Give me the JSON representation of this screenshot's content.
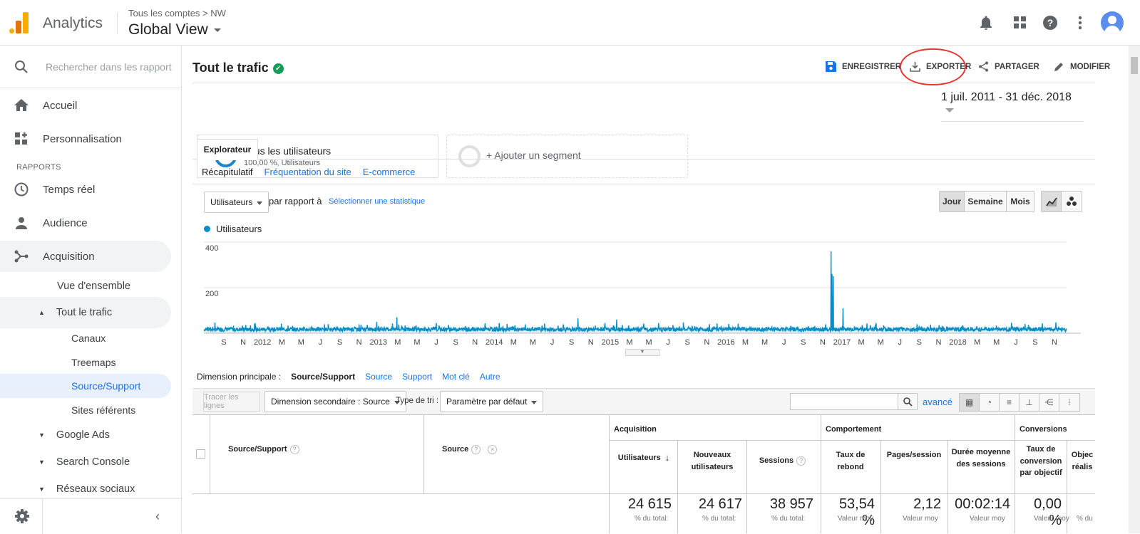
{
  "header": {
    "app_name": "Analytics",
    "breadcrumb": "Tous les comptes > NW",
    "view_name": "Global View",
    "icons": [
      "bell-icon",
      "apps-icon",
      "help-icon",
      "more-icon",
      "account-icon"
    ]
  },
  "sidebar": {
    "search_placeholder": "Rechercher dans les rapport",
    "home": "Accueil",
    "customization": "Personnalisation",
    "section_reports": "RAPPORTS",
    "realtime": "Temps réel",
    "audience": "Audience",
    "acquisition": "Acquisition",
    "overview": "Vue d'ensemble",
    "all_traffic": "Tout le trafic",
    "channels": "Canaux",
    "treemaps": "Treemaps",
    "source_medium": "Source/Support",
    "referrals": "Sites référents",
    "google_ads": "Google Ads",
    "search_console": "Search Console",
    "social": "Réseaux sociaux"
  },
  "page": {
    "title": "Tout le trafic",
    "actions": {
      "save": "ENREGISTRER",
      "export": "EXPORTER",
      "share": "PARTAGER",
      "edit": "MODIFIER"
    },
    "segment": {
      "name": "Tous les utilisateurs",
      "detail": "100,00 %, Utilisateurs",
      "add": "+ Ajouter un segment"
    },
    "date_range": "1 juil. 2011 - 31 déc. 2018",
    "tab": "Explorateur",
    "subtabs": [
      "Récapitulatif",
      "Fréquentation du site",
      "E-commerce"
    ],
    "metric_select": "Utilisateurs",
    "vs_label": "par rapport à",
    "select_metric_link": "Sélectionner une statistique",
    "period_buttons": [
      "Jour",
      "Semaine",
      "Mois"
    ],
    "active_period": "Jour"
  },
  "chart_data": {
    "type": "line",
    "series": [
      {
        "name": "Utilisateurs",
        "color": "#058dc7"
      }
    ],
    "y_ticks": [
      "400",
      "200"
    ],
    "ylim": [
      0,
      400
    ],
    "x_ticks": [
      "S",
      "N",
      "2012",
      "M",
      "M",
      "J",
      "S",
      "N",
      "2013",
      "M",
      "M",
      "J",
      "S",
      "N",
      "2014",
      "M",
      "M",
      "J",
      "S",
      "N",
      "2015",
      "M",
      "M",
      "J",
      "S",
      "N",
      "2016",
      "M",
      "M",
      "J",
      "S",
      "N",
      "2017",
      "M",
      "M",
      "J",
      "S",
      "N",
      "2018",
      "M",
      "M",
      "J",
      "S",
      "N"
    ],
    "x_range": [
      "2011-07-01",
      "2018-12-31"
    ],
    "baseline_value": 20,
    "peaks": [
      {
        "date": "2016-12-13",
        "value": 360
      },
      {
        "date": "2016-12-16",
        "value": 260
      },
      {
        "date": "2016-12-20",
        "value": 250
      },
      {
        "date": "2017-01-20",
        "value": 110
      },
      {
        "date": "2013-03-05",
        "value": 70
      },
      {
        "date": "2014-10-01",
        "value": 65
      },
      {
        "date": "2015-02-01",
        "value": 60
      }
    ]
  },
  "table": {
    "dimension_label": "Dimension principale :",
    "dimension_current": "Source/Support",
    "dimension_links": [
      "Source",
      "Support",
      "Mot clé",
      "Autre"
    ],
    "plot_rows_btn": "Tracer les lignes",
    "secondary_dim": "Dimension secondaire : Source",
    "sort_label": "Type de tri :",
    "sort_value": "Paramètre par défaut",
    "advanced": "avancé",
    "groups": [
      "Acquisition",
      "Comportement",
      "Conversions"
    ],
    "col_source_medium": "Source/Support",
    "col_source": "Source",
    "columns": [
      "Utilisateurs",
      "Nouveaux utilisateurs",
      "Sessions",
      "Taux de rebond",
      "Pages/session",
      "Durée moyenne des sessions",
      "Taux de conversion par objectif",
      "Objec réalis"
    ],
    "totals": [
      "24 615",
      "24 617",
      "38 957",
      "53,54 %",
      "2,12",
      "00:02:14",
      "0,00 %"
    ],
    "totals_sub": [
      "% du total:",
      "% du total:",
      "% du total:",
      "Valeur moy",
      "Valeur moy",
      "Valeur moy",
      "Valeur moy",
      "% du"
    ]
  }
}
